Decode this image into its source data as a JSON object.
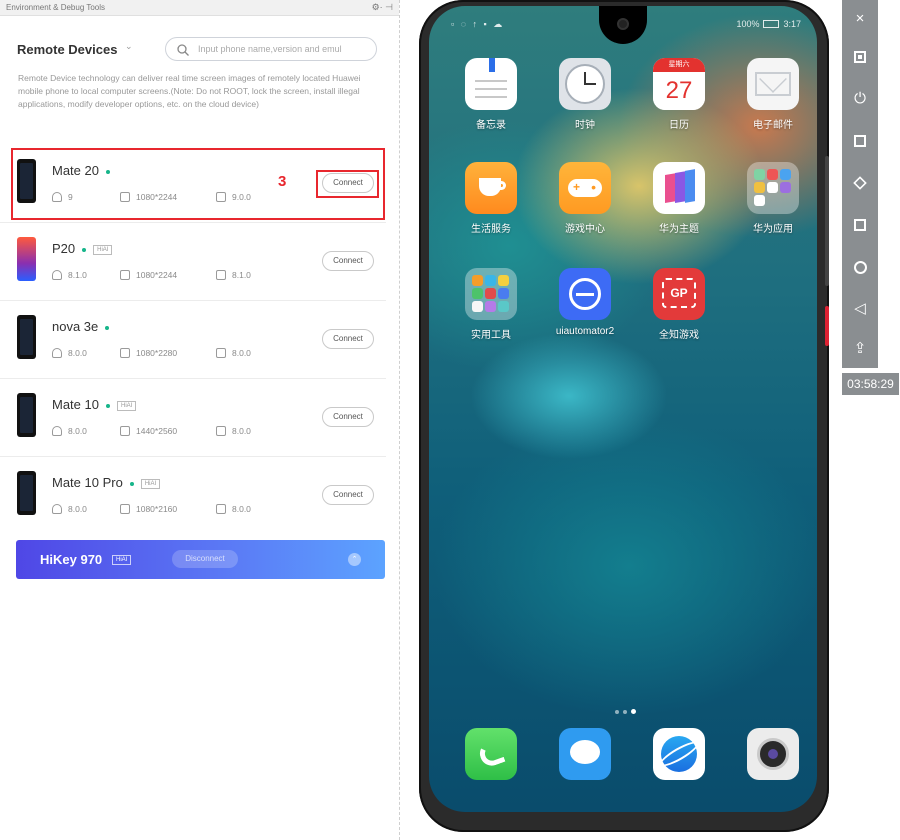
{
  "window": {
    "title": "Environment & Debug Tools",
    "tools": "⚙· ⊣"
  },
  "remote": {
    "title": "Remote Devices",
    "caret": "⌄",
    "search_placeholder": "Input phone name,version and emul",
    "description": "Remote Device technology can deliver real time screen images of remotely located Huawei mobile phone to local computer screens.(Note: Do not ROOT, lock the screen, install illegal applications, modify developer options, etc. on the cloud device)"
  },
  "devices": [
    {
      "name": "Mate 20",
      "tag": "",
      "users": "9",
      "resolution": "1080*2244",
      "version": "9.0.0",
      "button": "Connect"
    },
    {
      "name": "P20",
      "tag": "HiAI",
      "users": "8.1.0",
      "resolution": "1080*2244",
      "version": "8.1.0",
      "button": "Connect"
    },
    {
      "name": "nova 3e",
      "tag": "",
      "users": "8.0.0",
      "resolution": "1080*2280",
      "version": "8.0.0",
      "button": "Connect"
    },
    {
      "name": "Mate 10",
      "tag": "HiAI",
      "users": "8.0.0",
      "resolution": "1440*2560",
      "version": "8.0.0",
      "button": "Connect"
    },
    {
      "name": "Mate 10 Pro",
      "tag": "HiAI",
      "users": "8.0.0",
      "resolution": "1080*2160",
      "version": "8.0.0",
      "button": "Connect"
    }
  ],
  "annotation": {
    "number": "3",
    "color": "#e8272e"
  },
  "hikey": {
    "name": "HiKey 970",
    "tag": "HiAI",
    "status": "Disconnect",
    "collapse_icon": "⌃"
  },
  "phone": {
    "status_left": "▫ ◌ ↑ ▪ ☁",
    "status_right": "100%",
    "time": "3:17",
    "calendar": {
      "weekday": "星期六",
      "day": "27"
    },
    "apps": [
      {
        "label": "备忘录",
        "icon": "memo-icon"
      },
      {
        "label": "时钟",
        "icon": "clock-icon"
      },
      {
        "label": "日历",
        "icon": "calendar-icon"
      },
      {
        "label": "电子邮件",
        "icon": "mail-icon"
      },
      {
        "label": "生活服务",
        "icon": "life-service-icon"
      },
      {
        "label": "游戏中心",
        "icon": "game-center-icon"
      },
      {
        "label": "华为主题",
        "icon": "theme-icon"
      },
      {
        "label": "华为应用",
        "icon": "folder-icon"
      },
      {
        "label": "实用工具",
        "icon": "tools-folder-icon"
      },
      {
        "label": "uiautomator2",
        "icon": "uiautomator-icon"
      },
      {
        "label": "全知游戏",
        "icon": "gp-icon"
      }
    ],
    "gp_text": "GP",
    "page_indicator": {
      "pages": 3,
      "current": 3
    },
    "dock": [
      {
        "icon": "phone-icon"
      },
      {
        "icon": "messages-icon"
      },
      {
        "icon": "browser-icon"
      },
      {
        "icon": "camera-icon"
      }
    ]
  },
  "toolbar": {
    "close": "×",
    "power": "⏻",
    "home": "○",
    "back": "◁",
    "upload": "⇪",
    "timer": "03:58:29"
  }
}
